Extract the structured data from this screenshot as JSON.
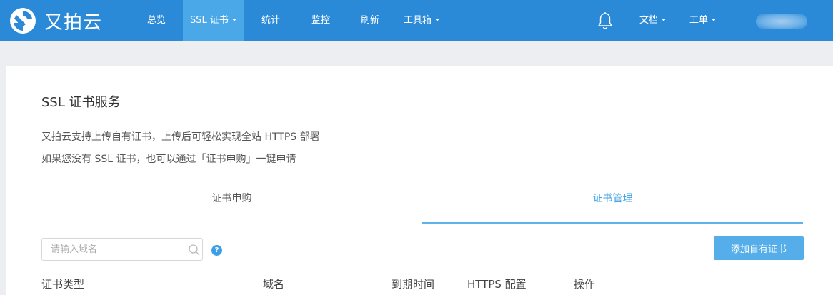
{
  "brand": {
    "name": "又拍云"
  },
  "nav": {
    "items": [
      {
        "label": "总览",
        "caret": false,
        "active": false
      },
      {
        "label": "SSL 证书",
        "caret": true,
        "active": true
      },
      {
        "label": "统计",
        "caret": false,
        "active": false
      },
      {
        "label": "监控",
        "caret": false,
        "active": false
      },
      {
        "label": "刷新",
        "caret": false,
        "active": false
      },
      {
        "label": "工具箱",
        "caret": true,
        "active": false
      }
    ],
    "right": [
      {
        "label": "文档",
        "caret": true
      },
      {
        "label": "工单",
        "caret": true
      }
    ]
  },
  "page": {
    "title": "SSL 证书服务",
    "desc_line1": "又拍云支持上传自有证书，上传后可轻松实现全站 HTTPS 部署",
    "desc_line2": "如果您没有 SSL 证书，也可以通过「证书申购」一键申请"
  },
  "tabs": [
    {
      "label": "证书申购",
      "active": false
    },
    {
      "label": "证书管理",
      "active": true
    }
  ],
  "search": {
    "placeholder": "请输入域名",
    "value": ""
  },
  "help": {
    "glyph": "?"
  },
  "add_button": {
    "label": "添加自有证书"
  },
  "table": {
    "headers": [
      "证书类型",
      "域名",
      "到期时间",
      "HTTPS 配置",
      "操作"
    ]
  },
  "colors": {
    "nav_bg": "#2b8ad8",
    "nav_active": "#4aa7e8",
    "accent": "#3da0e6",
    "button": "#55aee9"
  }
}
